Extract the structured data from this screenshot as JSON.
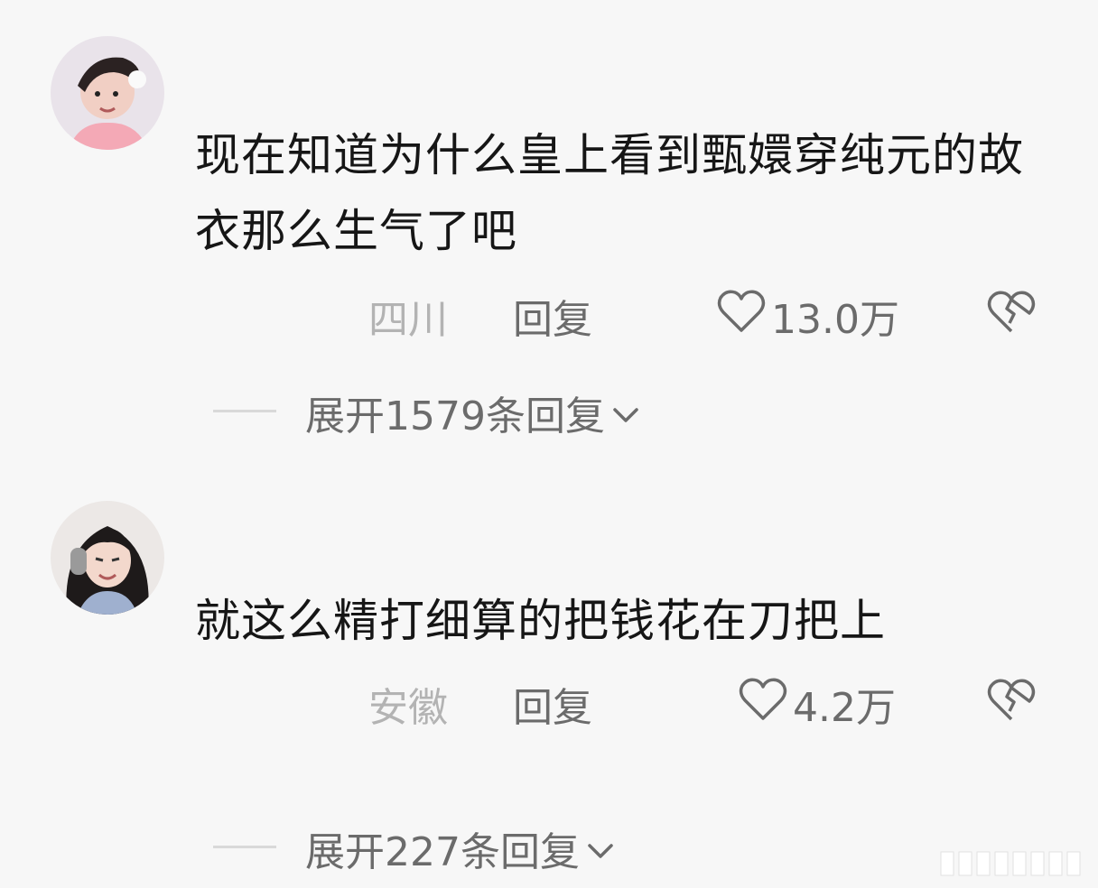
{
  "comments": [
    {
      "text": "现在知道为什么皇上看到甄嬛穿纯元的故衣那么生气了吧",
      "location": "四川",
      "reply_label": "回复",
      "likes": "13.0万",
      "expand_label": "展开1579条回复"
    },
    {
      "text": "就这么精打细算的把钱花在刀把上",
      "location": "安徽",
      "reply_label": "回复",
      "likes": "4.2万",
      "expand_label": "展开227条回复"
    }
  ],
  "icons": {
    "like": "heart-outline-icon",
    "dislike": "broken-heart-icon",
    "expand": "chevron-down-icon"
  },
  "colors": {
    "background": "#f7f7f7",
    "text": "#161616",
    "muted": "#6b6b6b",
    "location": "#b3b3b3"
  }
}
